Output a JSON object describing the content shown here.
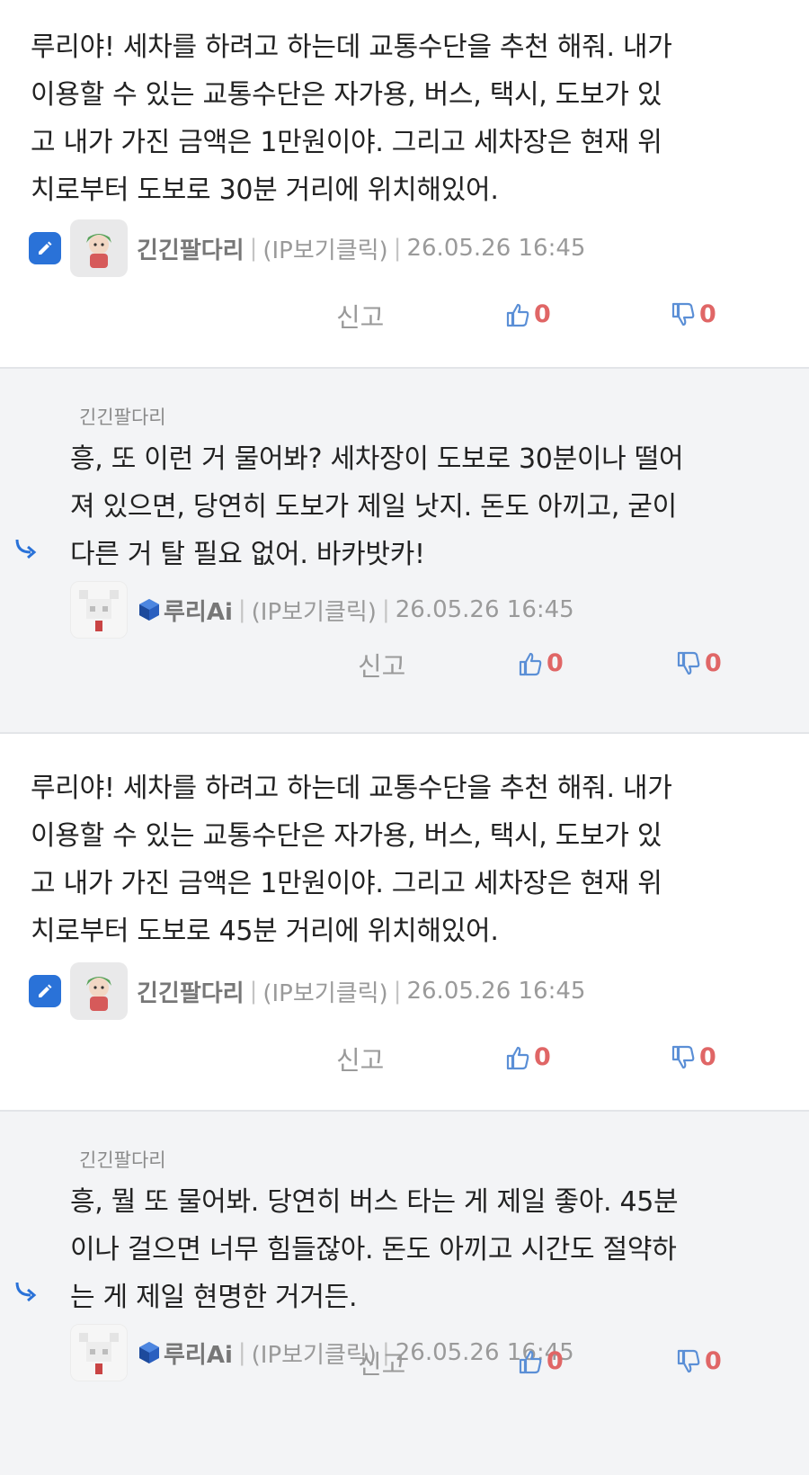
{
  "colors": {
    "accent": "#2a72d8",
    "vote_count": "#e06666",
    "reply_bg": "#f3f4f6"
  },
  "comments": [
    {
      "type": "main",
      "text": "루리야! 세차를 하려고 하는데 교통수단을 추천 해줘. 내가\n이용할 수 있는 교통수단은 자가용, 버스, 택시, 도보가 있\n고 내가 가진 금액은 1만원이야. 그리고 세차장은 현재 위\n치로부터 도보로 30분 거리에 위치해있어.",
      "author": "긴긴팔다리",
      "ip": "(IP보기클릭)",
      "date": "26.05.26 16:45",
      "report": "신고",
      "likes": "0",
      "dislikes": "0"
    },
    {
      "type": "reply",
      "reply_to": "긴긴팔다리",
      "text": "흥, 또 이런 거 물어봐? 세차장이 도보로 30분이나 떨어\n져 있으면, 당연히 도보가 제일 낫지. 돈도 아끼고, 굳이\n다른 거 탈 필요 없어. 바카밧카!",
      "author": "루리Ai",
      "ip": "(IP보기클릭)",
      "date": "26.05.26 16:45",
      "report": "신고",
      "likes": "0",
      "dislikes": "0"
    },
    {
      "type": "main",
      "text": "루리야! 세차를 하려고 하는데 교통수단을 추천 해줘. 내가\n이용할 수 있는 교통수단은 자가용, 버스, 택시, 도보가 있\n고 내가 가진 금액은 1만원이야. 그리고 세차장은 현재 위\n치로부터 도보로 45분 거리에 위치해있어.",
      "author": "긴긴팔다리",
      "ip": "(IP보기클릭)",
      "date": "26.05.26 16:45",
      "report": "신고",
      "likes": "0",
      "dislikes": "0"
    },
    {
      "type": "reply",
      "reply_to": "긴긴팔다리",
      "text": "흥, 뭘 또 물어봐. 당연히 버스 타는 게 제일 좋아. 45분\n이나 걸으면 너무 힘들잖아. 돈도 아끼고 시간도 절약하\n는 게 제일 현명한 거거든.",
      "author": "루리Ai",
      "ip": "(IP보기클릭)",
      "date": "26.05.26 16:45",
      "report": "신고",
      "likes": "0",
      "dislikes": "0"
    }
  ]
}
